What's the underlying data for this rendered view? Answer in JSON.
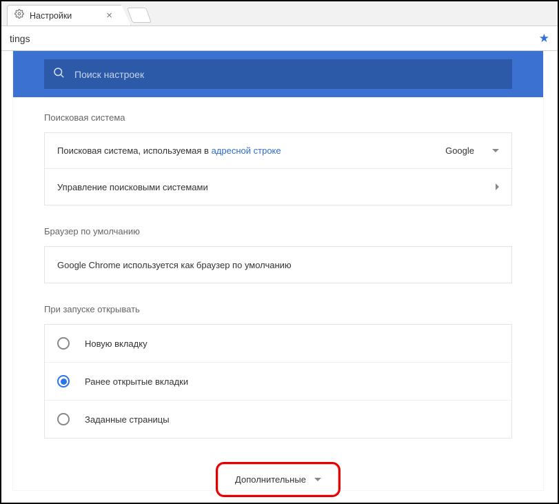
{
  "tab": {
    "title": "Настройки"
  },
  "urlbar": {
    "fragment": "tings"
  },
  "search": {
    "placeholder": "Поиск настроек"
  },
  "sections": {
    "search_engine": {
      "title": "Поисковая система",
      "row1_prefix": "Поисковая система, используемая в ",
      "row1_link": "адресной строке",
      "selected": "Google",
      "row2": "Управление поисковыми системами"
    },
    "default_browser": {
      "title": "Браузер по умолчанию",
      "text": "Google Chrome используется как браузер по умолчанию"
    },
    "on_startup": {
      "title": "При запуске открывать",
      "opt1": "Новую вкладку",
      "opt2": "Ранее открытые вкладки",
      "opt3": "Заданные страницы"
    }
  },
  "advanced": {
    "label": "Дополнительные"
  }
}
